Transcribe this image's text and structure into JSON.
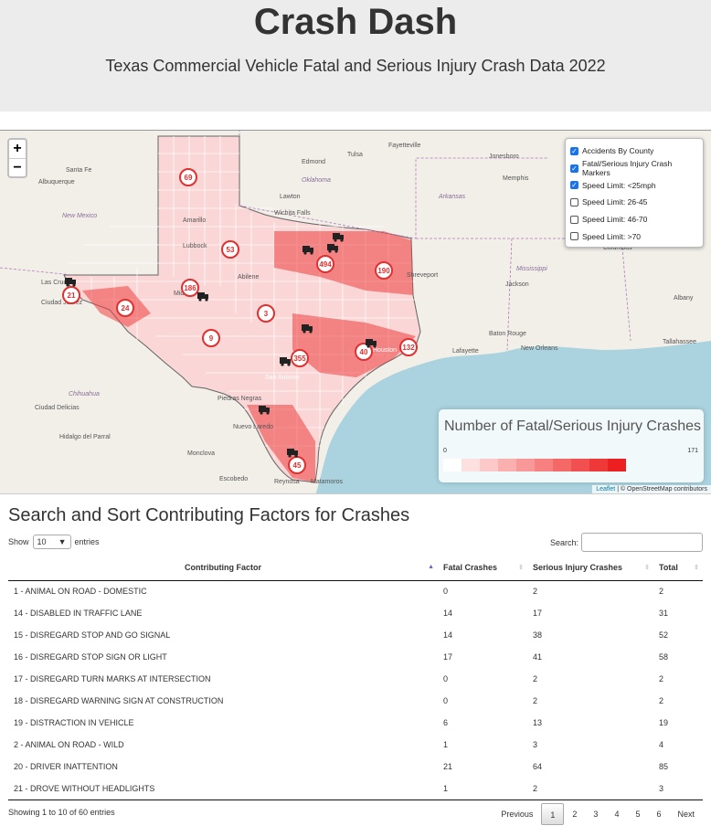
{
  "header": {
    "title": "Crash Dash",
    "subtitle": "Texas Commercial Vehicle Fatal and Serious Injury Crash Data 2022"
  },
  "map": {
    "zoom_in": "+",
    "zoom_out": "−",
    "place_labels": [
      "Santa Fe",
      "Albuquerque",
      "New Mexico",
      "Las Cruces",
      "Ciudad Juárez",
      "Chihuahua",
      "Ciudad Delicias",
      "Hidalgo del Parral",
      "Monclova",
      "Escobedo",
      "Piedras Negras",
      "Nuevo Laredo",
      "Reynosa",
      "Matamoros",
      "Tulsa",
      "Oklahoma",
      "Edmond",
      "Lawton",
      "Wichita Falls",
      "Amarillo",
      "Lubbock",
      "Abilene",
      "Midland",
      "Fayetteville",
      "Jonesboro",
      "Memphis",
      "Arkansas",
      "Shreveport",
      "Mississippi",
      "Jackson",
      "Columbus",
      "Albany",
      "Baton Rouge",
      "Lafayette",
      "New Orleans",
      "Tallahassee",
      "San Antonio",
      "Houston"
    ],
    "cluster_markers": [
      "69",
      "53",
      "21",
      "186",
      "24",
      "3",
      "9",
      "494",
      "190",
      "355",
      "40",
      "132",
      "45"
    ],
    "layers": [
      {
        "label": "Accidents By County",
        "checked": true
      },
      {
        "label": "Fatal/Serious Injury Crash Markers",
        "checked": true
      },
      {
        "label": "Speed Limit: <25mph",
        "checked": true
      },
      {
        "label": "Speed Limit: 26-45",
        "checked": false
      },
      {
        "label": "Speed Limit: 46-70",
        "checked": false
      },
      {
        "label": "Speed Limit: >70",
        "checked": false
      }
    ],
    "legend": {
      "title": "Number of Fatal/Serious Injury Crashes",
      "min": "0",
      "max": "171",
      "colors": [
        "#ffffff",
        "#fde0e0",
        "#fcc8c8",
        "#fbb0b0",
        "#f99898",
        "#f78080",
        "#f56868",
        "#f25050",
        "#ef3838",
        "#ec2020"
      ]
    },
    "attribution_leaflet": "Leaflet",
    "attribution_rest": " | © OpenStreetMap contributors"
  },
  "table_section": {
    "title": "Search and Sort Contributing Factors for Crashes",
    "show_label": "Show",
    "entries_value": "10",
    "entries_label": "entries",
    "search_label": "Search:",
    "search_value": "",
    "columns": [
      "Contributing Factor",
      "Fatal Crashes",
      "Serious Injury Crashes",
      "Total"
    ],
    "rows": [
      [
        "1 - ANIMAL ON ROAD - DOMESTIC",
        "0",
        "2",
        "2"
      ],
      [
        "14 - DISABLED IN TRAFFIC LANE",
        "14",
        "17",
        "31"
      ],
      [
        "15 - DISREGARD STOP AND GO SIGNAL",
        "14",
        "38",
        "52"
      ],
      [
        "16 - DISREGARD STOP SIGN OR LIGHT",
        "17",
        "41",
        "58"
      ],
      [
        "17 - DISREGARD TURN MARKS AT INTERSECTION",
        "0",
        "2",
        "2"
      ],
      [
        "18 - DISREGARD WARNING SIGN AT CONSTRUCTION",
        "0",
        "2",
        "2"
      ],
      [
        "19 - DISTRACTION IN VEHICLE",
        "6",
        "13",
        "19"
      ],
      [
        "2 - ANIMAL ON ROAD - WILD",
        "1",
        "3",
        "4"
      ],
      [
        "20 - DRIVER INATTENTION",
        "21",
        "64",
        "85"
      ],
      [
        "21 - DROVE WITHOUT HEADLIGHTS",
        "1",
        "2",
        "3"
      ]
    ],
    "info": "Showing 1 to 10 of 60 entries",
    "pager": {
      "previous": "Previous",
      "pages": [
        "1",
        "2",
        "3",
        "4",
        "5",
        "6"
      ],
      "current": "1",
      "next": "Next"
    }
  }
}
